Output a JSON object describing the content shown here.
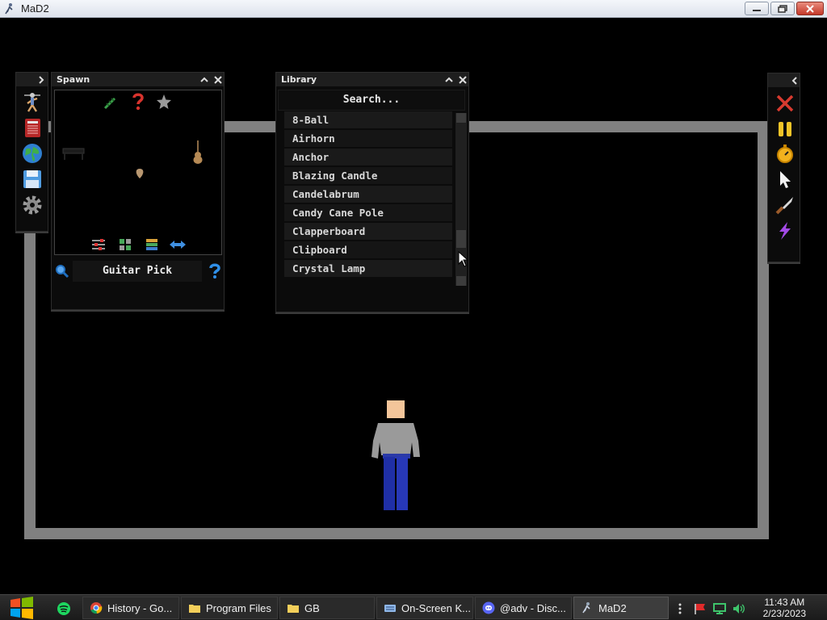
{
  "window": {
    "title": "MaD2"
  },
  "left_toolbar": {
    "icons": [
      "figure-icon",
      "notebook-icon",
      "globe-icon",
      "save-icon",
      "gear-icon"
    ]
  },
  "spawn_panel": {
    "title": "Spawn",
    "selected_item": "Guitar Pick",
    "category_icons": [
      "syringe-icon",
      "question-icon",
      "star-icon"
    ],
    "bottom_icons": [
      "sliders-icon",
      "grid-icon",
      "list-icon",
      "swap-arrows-icon"
    ]
  },
  "library_panel": {
    "title": "Library",
    "search_placeholder": "Search...",
    "items": [
      "8-Ball",
      "Airhorn",
      "Anchor",
      "Blazing Candle",
      "Candelabrum",
      "Candy Cane Pole",
      "Clapperboard",
      "Clipboard",
      "Crystal Lamp"
    ]
  },
  "right_toolbar": {
    "icons": [
      "close-x-icon",
      "pause-icon",
      "stopwatch-icon",
      "cursor-icon",
      "knife-icon",
      "lightning-icon"
    ]
  },
  "taskbar": {
    "items": [
      {
        "label": "History - Go..."
      },
      {
        "label": "Program Files"
      },
      {
        "label": "GB"
      },
      {
        "label": "On-Screen K..."
      },
      {
        "label": "@adv - Disc..."
      },
      {
        "label": "MaD2"
      }
    ],
    "time": "11:43 AM",
    "date": "2/23/2023"
  },
  "colors": {
    "wall": "#808080",
    "background": "#000000"
  }
}
